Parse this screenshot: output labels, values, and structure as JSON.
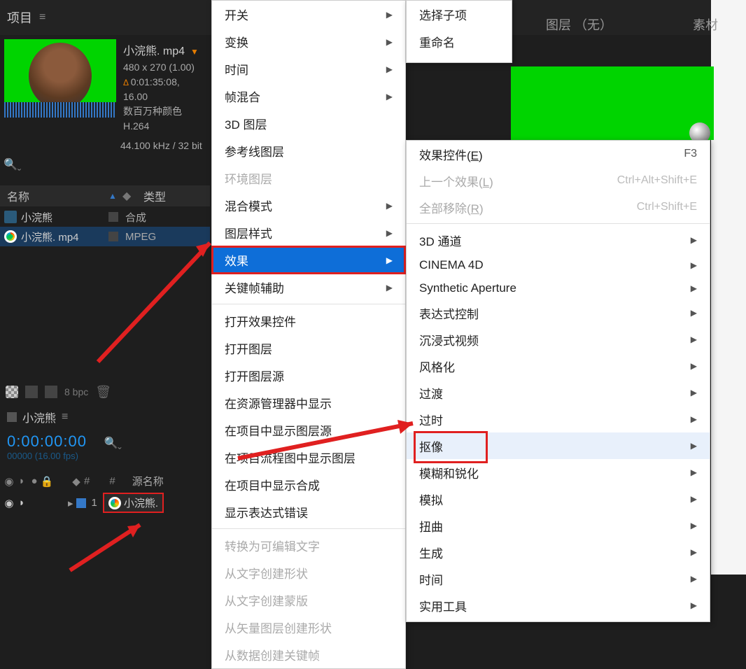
{
  "header": {
    "project_label": "项目",
    "layer_label": "图层   （无）",
    "source_label": "素材"
  },
  "file_info": {
    "name": "小浣熊. mp4",
    "dimensions": "480 x 270 (1.00)",
    "duration": "0:01:35:08, 16.00",
    "colors": "数百万种颜色",
    "codec": "H.264",
    "audio": "44.100 kHz / 32 bit"
  },
  "list_header": {
    "name": "名称",
    "type": "类型"
  },
  "list_rows": [
    {
      "name": "小浣熊",
      "type": "合成"
    },
    {
      "name": "小浣熊. mp4",
      "type": "MPEG"
    }
  ],
  "toolbar": {
    "bpc": "8 bpc"
  },
  "comp_panel": {
    "title": "小浣熊",
    "timecode": "0:00:00:00",
    "timecode_sub": "00000 (16.00 fps)"
  },
  "timeline_header": {
    "hash1": "#",
    "hash2": "#",
    "source_name": "源名称"
  },
  "timeline_row": {
    "index": "1",
    "name": "小浣熊."
  },
  "context_menu1": [
    {
      "label": "开关",
      "arrow": true
    },
    {
      "label": "变换",
      "arrow": true
    },
    {
      "label": "时间",
      "arrow": true
    },
    {
      "label": "帧混合",
      "arrow": true
    },
    {
      "label": "3D 图层"
    },
    {
      "label": "参考线图层"
    },
    {
      "label": "环境图层",
      "disabled": true
    },
    {
      "label": "混合模式",
      "arrow": true
    },
    {
      "label": "图层样式",
      "arrow": true
    },
    {
      "label": "效果",
      "arrow": true,
      "highlighted": true,
      "boxed": true
    },
    {
      "label": "关键帧辅助",
      "arrow": true
    },
    {
      "sep": true
    },
    {
      "label": "打开效果控件"
    },
    {
      "label": "打开图层"
    },
    {
      "label": "打开图层源"
    },
    {
      "label": "在资源管理器中显示"
    },
    {
      "label": "在项目中显示图层源"
    },
    {
      "label": "在项目流程图中显示图层"
    },
    {
      "label": "在项目中显示合成"
    },
    {
      "label": "显示表达式错误"
    },
    {
      "sep": true
    },
    {
      "label": "转换为可编辑文字",
      "disabled": true
    },
    {
      "label": "从文字创建形状",
      "disabled": true
    },
    {
      "label": "从文字创建蒙版",
      "disabled": true
    },
    {
      "label": "从矢量图层创建形状",
      "disabled": true
    },
    {
      "label": "从数据创建关键帧",
      "disabled": true
    }
  ],
  "context_menu2": [
    {
      "label": "选择子项"
    },
    {
      "label": "重命名"
    }
  ],
  "context_menu3": [
    {
      "label": "效果控件",
      "ul": "E",
      "shortcut": "F3"
    },
    {
      "label": "上一个效果",
      "ul": "L",
      "shortcut": "Ctrl+Alt+Shift+E",
      "disabled": true
    },
    {
      "label": "全部移除",
      "ul": "R",
      "shortcut": "Ctrl+Shift+E",
      "disabled": true
    },
    {
      "sep": true
    },
    {
      "label": "3D 通道",
      "arrow": true
    },
    {
      "label": "CINEMA 4D",
      "arrow": true
    },
    {
      "label": "Synthetic Aperture",
      "arrow": true
    },
    {
      "label": "表达式控制",
      "arrow": true
    },
    {
      "label": "沉浸式视频",
      "arrow": true
    },
    {
      "label": "风格化",
      "arrow": true
    },
    {
      "label": "过渡",
      "arrow": true
    },
    {
      "label": "过时",
      "arrow": true
    },
    {
      "label": "抠像",
      "arrow": true,
      "hover": true,
      "boxed": true
    },
    {
      "label": "模糊和锐化",
      "arrow": true
    },
    {
      "label": "模拟",
      "arrow": true
    },
    {
      "label": "扭曲",
      "arrow": true
    },
    {
      "label": "生成",
      "arrow": true
    },
    {
      "label": "时间",
      "arrow": true
    },
    {
      "label": "实用工具",
      "arrow": true
    }
  ]
}
